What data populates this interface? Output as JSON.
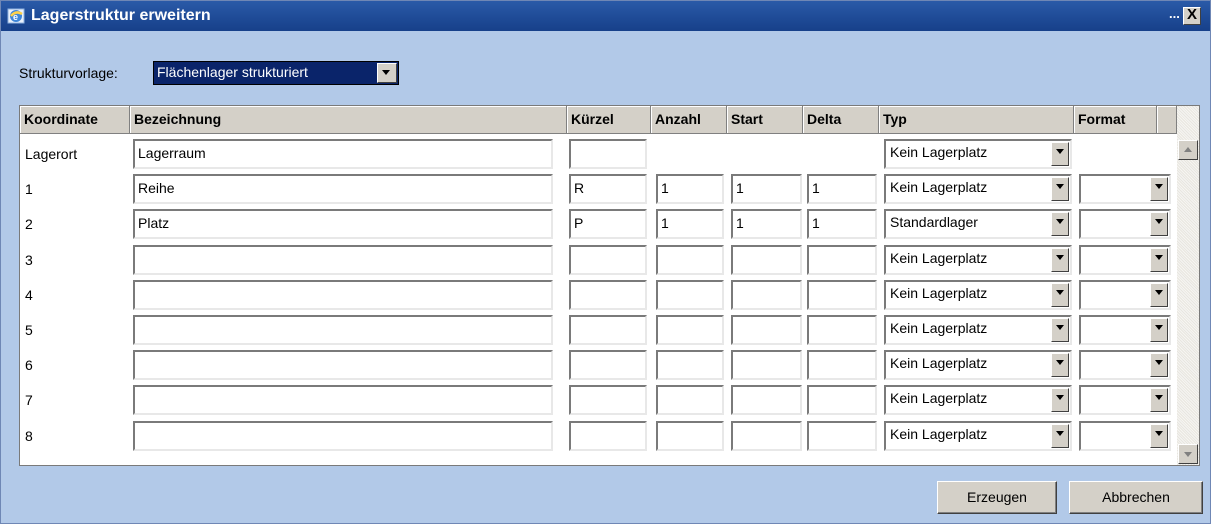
{
  "window": {
    "title": "Lagerstruktur erweitern",
    "title_dots": "...",
    "close_glyph": "X"
  },
  "template": {
    "label": "Strukturvorlage:",
    "selected": "Flächenlager strukturiert"
  },
  "columns": [
    "Koordinate",
    "Bezeichnung",
    "Kürzel",
    "Anzahl",
    "Start",
    "Delta",
    "Typ",
    "Format"
  ],
  "rows": [
    {
      "koordinate": "Lagerort",
      "bezeichnung": "Lagerraum",
      "kuerzel": "",
      "anzahl": "",
      "start": "",
      "delta": "",
      "typ": "Kein Lagerplatz",
      "format": ""
    },
    {
      "koordinate": "1",
      "bezeichnung": "Reihe",
      "kuerzel": "R",
      "anzahl": "1",
      "start": "1",
      "delta": "1",
      "typ": "Kein Lagerplatz",
      "format": ""
    },
    {
      "koordinate": "2",
      "bezeichnung": "Platz",
      "kuerzel": "P",
      "anzahl": "1",
      "start": "1",
      "delta": "1",
      "typ": "Standardlager",
      "format": ""
    },
    {
      "koordinate": "3",
      "bezeichnung": "",
      "kuerzel": "",
      "anzahl": "",
      "start": "",
      "delta": "",
      "typ": "Kein Lagerplatz",
      "format": ""
    },
    {
      "koordinate": "4",
      "bezeichnung": "",
      "kuerzel": "",
      "anzahl": "",
      "start": "",
      "delta": "",
      "typ": "Kein Lagerplatz",
      "format": ""
    },
    {
      "koordinate": "5",
      "bezeichnung": "",
      "kuerzel": "",
      "anzahl": "",
      "start": "",
      "delta": "",
      "typ": "Kein Lagerplatz",
      "format": ""
    },
    {
      "koordinate": "6",
      "bezeichnung": "",
      "kuerzel": "",
      "anzahl": "",
      "start": "",
      "delta": "",
      "typ": "Kein Lagerplatz",
      "format": ""
    },
    {
      "koordinate": "7",
      "bezeichnung": "",
      "kuerzel": "",
      "anzahl": "",
      "start": "",
      "delta": "",
      "typ": "Kein Lagerplatz",
      "format": ""
    },
    {
      "koordinate": "8",
      "bezeichnung": "",
      "kuerzel": "",
      "anzahl": "",
      "start": "",
      "delta": "",
      "typ": "Kein Lagerplatz",
      "format": ""
    }
  ],
  "buttons": {
    "create": "Erzeugen",
    "cancel": "Abbrechen"
  },
  "colors": {
    "titlebar": "#1e4a96",
    "dialog_bg": "#b2c9e8",
    "selection": "#0a246a"
  }
}
